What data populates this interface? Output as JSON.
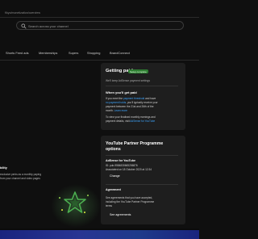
{
  "url": "f/kyc/monetization/overview",
  "search": {
    "placeholder": "Search across your channel"
  },
  "tabs": [
    "Shorts Feed ads",
    "Memberships",
    "Supers",
    "Shopping",
    "BrandConnect"
  ],
  "getting_paid": {
    "title": "Getting paid",
    "badge": "Setup complete",
    "subtitle": "We'll keep AdSense payment settings",
    "when_heading": "When you'll get paid",
    "line1_a": "If you meet the ",
    "line1_link": "payment threshold",
    "line1_b": " and have",
    "line2_link": "no payment holds",
    "line2_b": ", you'll typically receive your",
    "line3": "payment between the 21st and 26th of the",
    "line4": "month.",
    "line4_link": "Learn more",
    "line5": "To view your finalised monthly earnings and",
    "line6_a": "payment details, visit ",
    "line6_link": "AdSense for YouTube"
  },
  "partner": {
    "title_line1": "YouTube Partner Programme",
    "title_line2": "options",
    "adsense_heading": "AdSense for YouTube",
    "pub_id": "ID: pub-9584830665206876",
    "associated": "Associated on 18 October 2020 at 12:34",
    "change_label": "Change",
    "agreements_heading": "Agreement",
    "agreements_line1": "See agreements that you have accepted,",
    "agreements_line2": "including the YouTube Partner Programme",
    "agreements_line3": "terms",
    "see_agreements_label": "See agreements"
  },
  "left": {
    "heading_fragment": "bility",
    "line1": "exclusive perks as a monthly paying",
    "line2": "from your channel and video pages"
  },
  "colors": {
    "accent_link": "#3ea6ff",
    "badge_bg": "#2e7d32",
    "bottom_bar": "#1e3a8a"
  }
}
